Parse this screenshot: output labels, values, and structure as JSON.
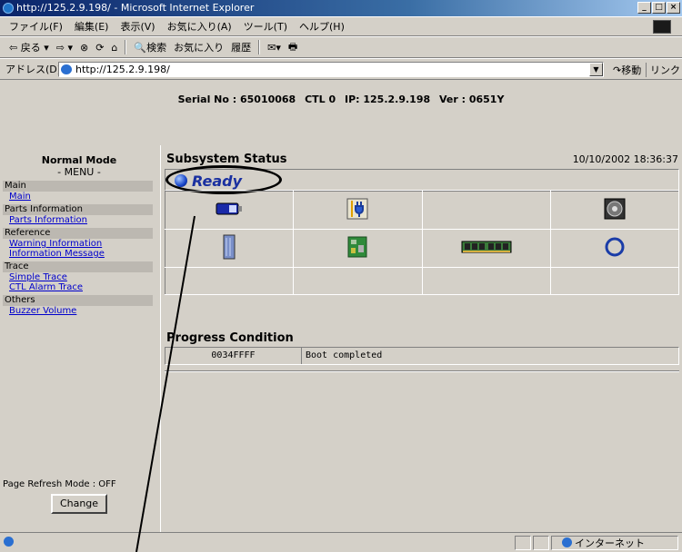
{
  "window": {
    "title": "http://125.2.9.198/ - Microsoft Internet Explorer"
  },
  "menubar": {
    "items": [
      "ファイル(F)",
      "編集(E)",
      "表示(V)",
      "お気に入り(A)",
      "ツール(T)",
      "ヘルプ(H)"
    ]
  },
  "toolbar": {
    "back": "⇦ 戻る ▾",
    "forward": "⇨ ▾",
    "stop": "⊗",
    "refresh": "⟳",
    "home": "⌂",
    "search": "🔍検索",
    "favorites": "お気に入り",
    "history": "履歴",
    "mail": "✉▾",
    "print": "🖶"
  },
  "address": {
    "label": "アドレス(D)",
    "value": "http://125.2.9.198/",
    "go": "移動",
    "links": "リンク"
  },
  "serial": {
    "serial": "Serial No : 65010068",
    "ctl": "CTL 0",
    "ip": "IP: 125.2.9.198",
    "ver": "Ver : 0651Y"
  },
  "sidebar": {
    "mode": "Normal Mode",
    "menu": "- MENU -",
    "groups": [
      {
        "header": "Main",
        "links": [
          "Main"
        ]
      },
      {
        "header": "Parts Information",
        "links": [
          "Parts Information"
        ]
      },
      {
        "header": "Reference",
        "links": [
          "Warning Information",
          "Information Message"
        ]
      },
      {
        "header": "Trace",
        "links": [
          "Simple Trace",
          "CTL Alarm Trace"
        ]
      },
      {
        "header": "Others",
        "links": [
          "Buzzer Volume"
        ]
      }
    ],
    "refresh_mode": "Page Refresh Mode : OFF",
    "change": "Change"
  },
  "main": {
    "title": "Subsystem Status",
    "datetime": "10/10/2002 18:36:37",
    "status": "Ready",
    "status_color": "#1a30a0",
    "progress_title": "Progress Condition",
    "progress": {
      "code": "0034FFFF",
      "message": "Boot completed"
    }
  },
  "statusbar": {
    "zone": "インターネット"
  }
}
